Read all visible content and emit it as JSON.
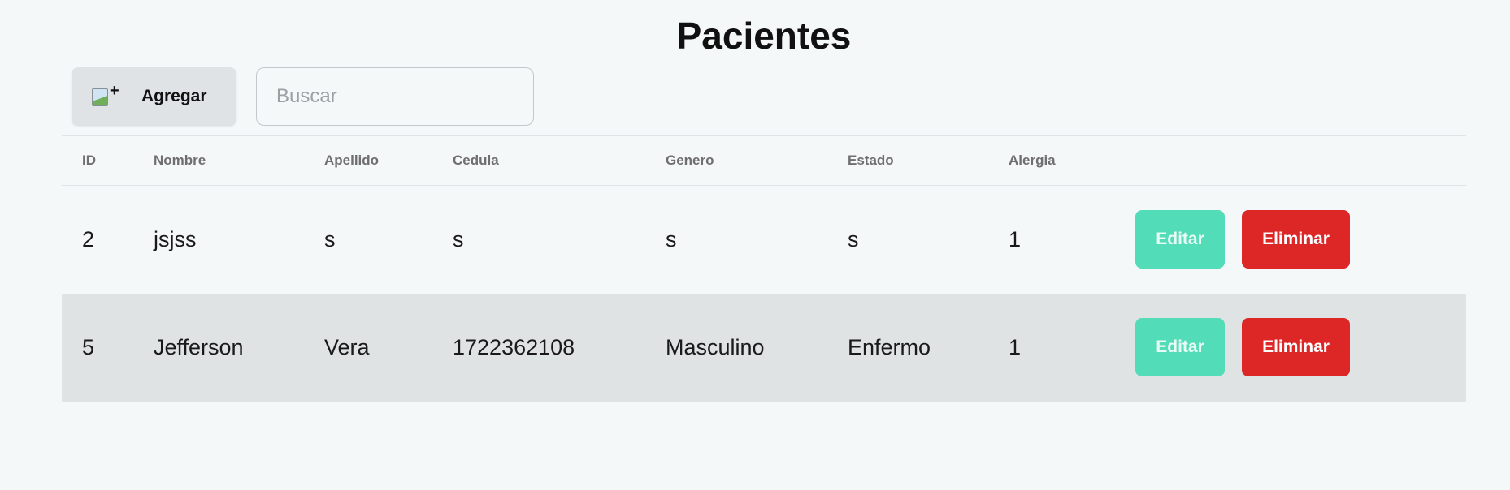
{
  "page": {
    "title": "Pacientes"
  },
  "toolbar": {
    "add_icon": "broken-image-plus-icon",
    "add_label": "Agregar",
    "search_placeholder": "Buscar",
    "search_value": ""
  },
  "table": {
    "columns": [
      "ID",
      "Nombre",
      "Apellido",
      "Cedula",
      "Genero",
      "Estado",
      "Alergia",
      ""
    ],
    "rows": [
      {
        "id": "2",
        "nombre": "jsjss",
        "apellido": "s",
        "cedula": "s",
        "genero": "s",
        "estado": "s",
        "alergia": "1",
        "edit_label": "Editar",
        "delete_label": "Eliminar"
      },
      {
        "id": "5",
        "nombre": "Jefferson",
        "apellido": "Vera",
        "cedula": "1722362108",
        "genero": "Masculino",
        "estado": "Enfermo",
        "alergia": "1",
        "edit_label": "Editar",
        "delete_label": "Eliminar"
      }
    ]
  },
  "colors": {
    "background": "#f4f8f9",
    "edit_button": "#52dcb8",
    "delete_button": "#dd2626",
    "alt_row": "#dfe3e4",
    "add_button": "#dfe3e5"
  }
}
